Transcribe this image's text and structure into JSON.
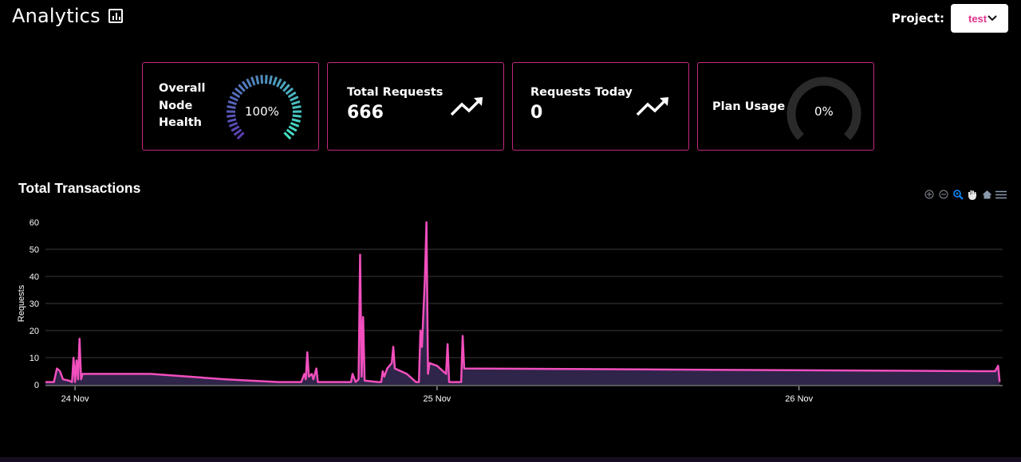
{
  "header": {
    "title": "Analytics",
    "title_icon": "bar-chart-icon",
    "project_label": "Project:",
    "project_value": "test",
    "project_dropdown_icon": "chevron-down-icon"
  },
  "cards": [
    {
      "label_lines": [
        "Overall",
        "Node",
        "Health"
      ],
      "gauge_value_text": "100%",
      "gauge_fraction": 1.0,
      "gauge_colors": [
        "#5b3fb5",
        "#44e0c4"
      ]
    },
    {
      "label": "Total Requests",
      "value": "666",
      "icon": "trending-up-icon"
    },
    {
      "label": "Requests Today",
      "value": "0",
      "icon": "trending-up-icon"
    },
    {
      "label": "Plan Usage",
      "gauge_value_text": "0%",
      "gauge_fraction": 0.0,
      "track_color": "#2a2a2a"
    }
  ],
  "chart": {
    "toolbar": [
      {
        "name": "zoom-in-icon",
        "glyph": "⊕",
        "active": false
      },
      {
        "name": "zoom-out-icon",
        "glyph": "⊖",
        "active": false
      },
      {
        "name": "selection-zoom-icon",
        "glyph": "zoom",
        "active": true
      },
      {
        "name": "pan-hand-icon",
        "glyph": "hand",
        "active": false
      },
      {
        "name": "reset-home-icon",
        "glyph": "home",
        "active": false
      },
      {
        "name": "menu-icon",
        "glyph": "menu",
        "active": false
      }
    ]
  },
  "chart_data": {
    "type": "area",
    "title": "Total Transactions",
    "xlabel": "",
    "ylabel": "Requests",
    "x_unit": "hours since 24 Nov 00:00",
    "xlim": [
      -1.96,
      61.5
    ],
    "ylim": [
      0,
      60
    ],
    "yticks": [
      0,
      10,
      20,
      30,
      40,
      50,
      60
    ],
    "xticks": [
      {
        "x": 0,
        "label": "24 Nov"
      },
      {
        "x": 24,
        "label": "25 Nov"
      },
      {
        "x": 48,
        "label": "26 Nov"
      }
    ],
    "grid": true,
    "line_color": "#f24fbd",
    "fill_color": "#2f2449",
    "series": [
      {
        "name": "Requests",
        "points": [
          [
            -1.96,
            1
          ],
          [
            -1.4,
            1
          ],
          [
            -1.2,
            6
          ],
          [
            -1.0,
            5
          ],
          [
            -0.8,
            2
          ],
          [
            -0.4,
            1.5
          ],
          [
            -0.2,
            1
          ],
          [
            -0.1,
            10
          ],
          [
            0.0,
            1
          ],
          [
            0.1,
            9
          ],
          [
            0.2,
            2
          ],
          [
            0.3,
            17
          ],
          [
            0.4,
            2
          ],
          [
            0.5,
            4
          ],
          [
            5.0,
            4
          ],
          [
            10.0,
            2
          ],
          [
            13.5,
            1
          ],
          [
            15.0,
            1
          ],
          [
            15.2,
            4
          ],
          [
            15.3,
            2
          ],
          [
            15.4,
            12
          ],
          [
            15.5,
            3
          ],
          [
            15.7,
            4
          ],
          [
            15.8,
            2
          ],
          [
            16.0,
            6
          ],
          [
            16.1,
            1
          ],
          [
            17.0,
            1
          ],
          [
            18.0,
            1
          ],
          [
            18.3,
            1
          ],
          [
            18.4,
            4
          ],
          [
            18.6,
            1
          ],
          [
            18.8,
            2
          ],
          [
            18.9,
            48
          ],
          [
            19.0,
            3
          ],
          [
            19.1,
            25
          ],
          [
            19.2,
            1.5
          ],
          [
            20.1,
            1
          ],
          [
            20.3,
            1
          ],
          [
            20.4,
            5
          ],
          [
            20.5,
            3
          ],
          [
            20.7,
            6
          ],
          [
            21.0,
            8
          ],
          [
            21.1,
            14
          ],
          [
            21.2,
            6
          ],
          [
            22.0,
            4
          ],
          [
            22.6,
            1
          ],
          [
            22.8,
            1
          ],
          [
            22.9,
            20
          ],
          [
            23.0,
            14
          ],
          [
            23.2,
            40
          ],
          [
            23.3,
            60
          ],
          [
            23.4,
            4
          ],
          [
            23.5,
            8
          ],
          [
            24.0,
            7
          ],
          [
            24.6,
            4
          ],
          [
            24.7,
            15
          ],
          [
            24.8,
            1
          ],
          [
            25.6,
            1
          ],
          [
            25.7,
            18
          ],
          [
            25.8,
            6
          ],
          [
            60.0,
            5
          ],
          [
            61.0,
            5
          ],
          [
            61.2,
            7
          ],
          [
            61.3,
            1
          ]
        ]
      }
    ]
  }
}
